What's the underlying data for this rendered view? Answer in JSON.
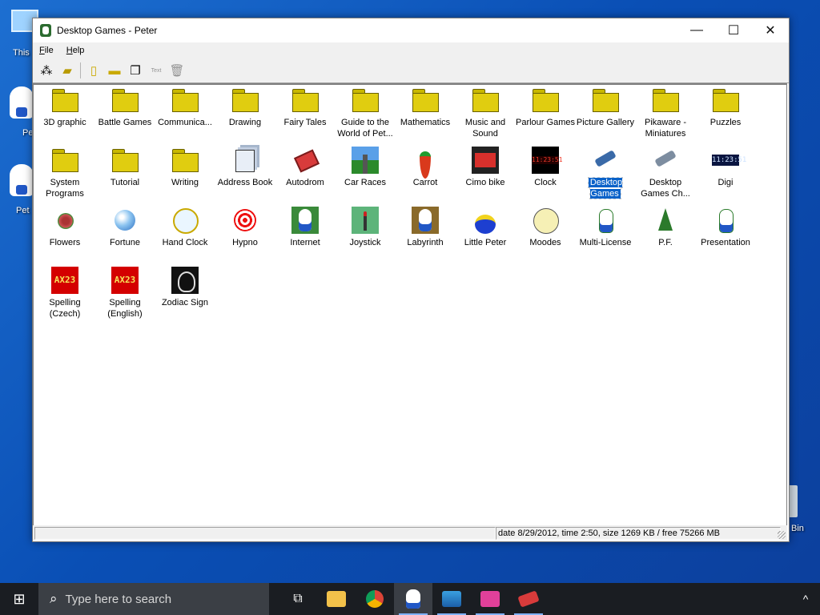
{
  "desktop": {
    "icons": [
      {
        "label": "This"
      },
      {
        "label": "Pe"
      },
      {
        "label": "Pet"
      },
      {
        "label": "Bin"
      }
    ]
  },
  "window": {
    "title": "Desktop Games - Peter",
    "controls": {
      "minimize": "—",
      "maximize": "☐",
      "close": "✕"
    }
  },
  "menu": [
    {
      "label": "File"
    },
    {
      "label": "Help"
    }
  ],
  "toolbar": {
    "disabled_tool_text": "Text"
  },
  "items": [
    {
      "label": "3D graphic",
      "icon": "folder-icon"
    },
    {
      "label": "Battle Games",
      "icon": "folder-icon"
    },
    {
      "label": "Communica...",
      "icon": "folder-icon"
    },
    {
      "label": "Drawing",
      "icon": "folder-icon"
    },
    {
      "label": "Fairy Tales",
      "icon": "folder-icon"
    },
    {
      "label": "Guide to the World of Pet...",
      "icon": "folder-icon"
    },
    {
      "label": "Mathematics",
      "icon": "folder-icon"
    },
    {
      "label": "Music and Sound",
      "icon": "folder-icon"
    },
    {
      "label": "Parlour Games",
      "icon": "folder-icon"
    },
    {
      "label": "Picture Gallery",
      "icon": "folder-icon"
    },
    {
      "label": "Pikaware - Miniatures",
      "icon": "folder-icon"
    },
    {
      "label": "Puzzles",
      "icon": "folder-icon"
    },
    {
      "label": "System Programs",
      "icon": "folder-icon"
    },
    {
      "label": "Tutorial",
      "icon": "folder-icon"
    },
    {
      "label": "Writing",
      "icon": "folder-icon"
    },
    {
      "label": "Address Book",
      "icon": "address-book-icon"
    },
    {
      "label": "Autodrom",
      "icon": "autodrom-icon"
    },
    {
      "label": "Car Races",
      "icon": "car-races-icon"
    },
    {
      "label": "Carrot",
      "icon": "carrot-icon"
    },
    {
      "label": "Cimo bike",
      "icon": "cimo-bike-icon"
    },
    {
      "label": "Clock",
      "icon": "digital-clock-icon"
    },
    {
      "label": "Desktop Games",
      "icon": "desktop-games-icon",
      "selected": true
    },
    {
      "label": "Desktop Games Ch...",
      "icon": "desktop-games-ch-icon"
    },
    {
      "label": "Digi",
      "icon": "digi-icon"
    },
    {
      "label": "Flowers",
      "icon": "flowers-icon"
    },
    {
      "label": "Fortune",
      "icon": "fortune-icon"
    },
    {
      "label": "Hand Clock",
      "icon": "hand-clock-icon"
    },
    {
      "label": "Hypno",
      "icon": "hypno-icon"
    },
    {
      "label": "Internet",
      "icon": "internet-icon"
    },
    {
      "label": "Joystick",
      "icon": "joystick-icon"
    },
    {
      "label": "Labyrinth",
      "icon": "labyrinth-icon"
    },
    {
      "label": "Little Peter",
      "icon": "pacifier-icon"
    },
    {
      "label": "Moodes",
      "icon": "smiley-icon"
    },
    {
      "label": "Multi-License",
      "icon": "multi-license-icon"
    },
    {
      "label": "P.F.",
      "icon": "tree-icon"
    },
    {
      "label": "Presentation",
      "icon": "presentation-icon"
    },
    {
      "label": "Spelling (Czech)",
      "icon": "ax23-icon"
    },
    {
      "label": "Spelling (English)",
      "icon": "ax23-icon"
    },
    {
      "label": "Zodiac Sign",
      "icon": "zodiac-icon"
    }
  ],
  "status": {
    "text": "date 8/29/2012, time 2:50, size 1269 KB / free 75266 MB"
  },
  "taskbar": {
    "search_placeholder": "Type here to search",
    "apps": [
      {
        "name": "task-view-icon"
      },
      {
        "name": "file-explorer-icon"
      },
      {
        "name": "chrome-icon"
      },
      {
        "name": "desktop-games-icon"
      },
      {
        "name": "shark-app-icon"
      },
      {
        "name": "pink-app-icon"
      },
      {
        "name": "red-car-app-icon"
      }
    ],
    "tray_chevron": "^"
  }
}
